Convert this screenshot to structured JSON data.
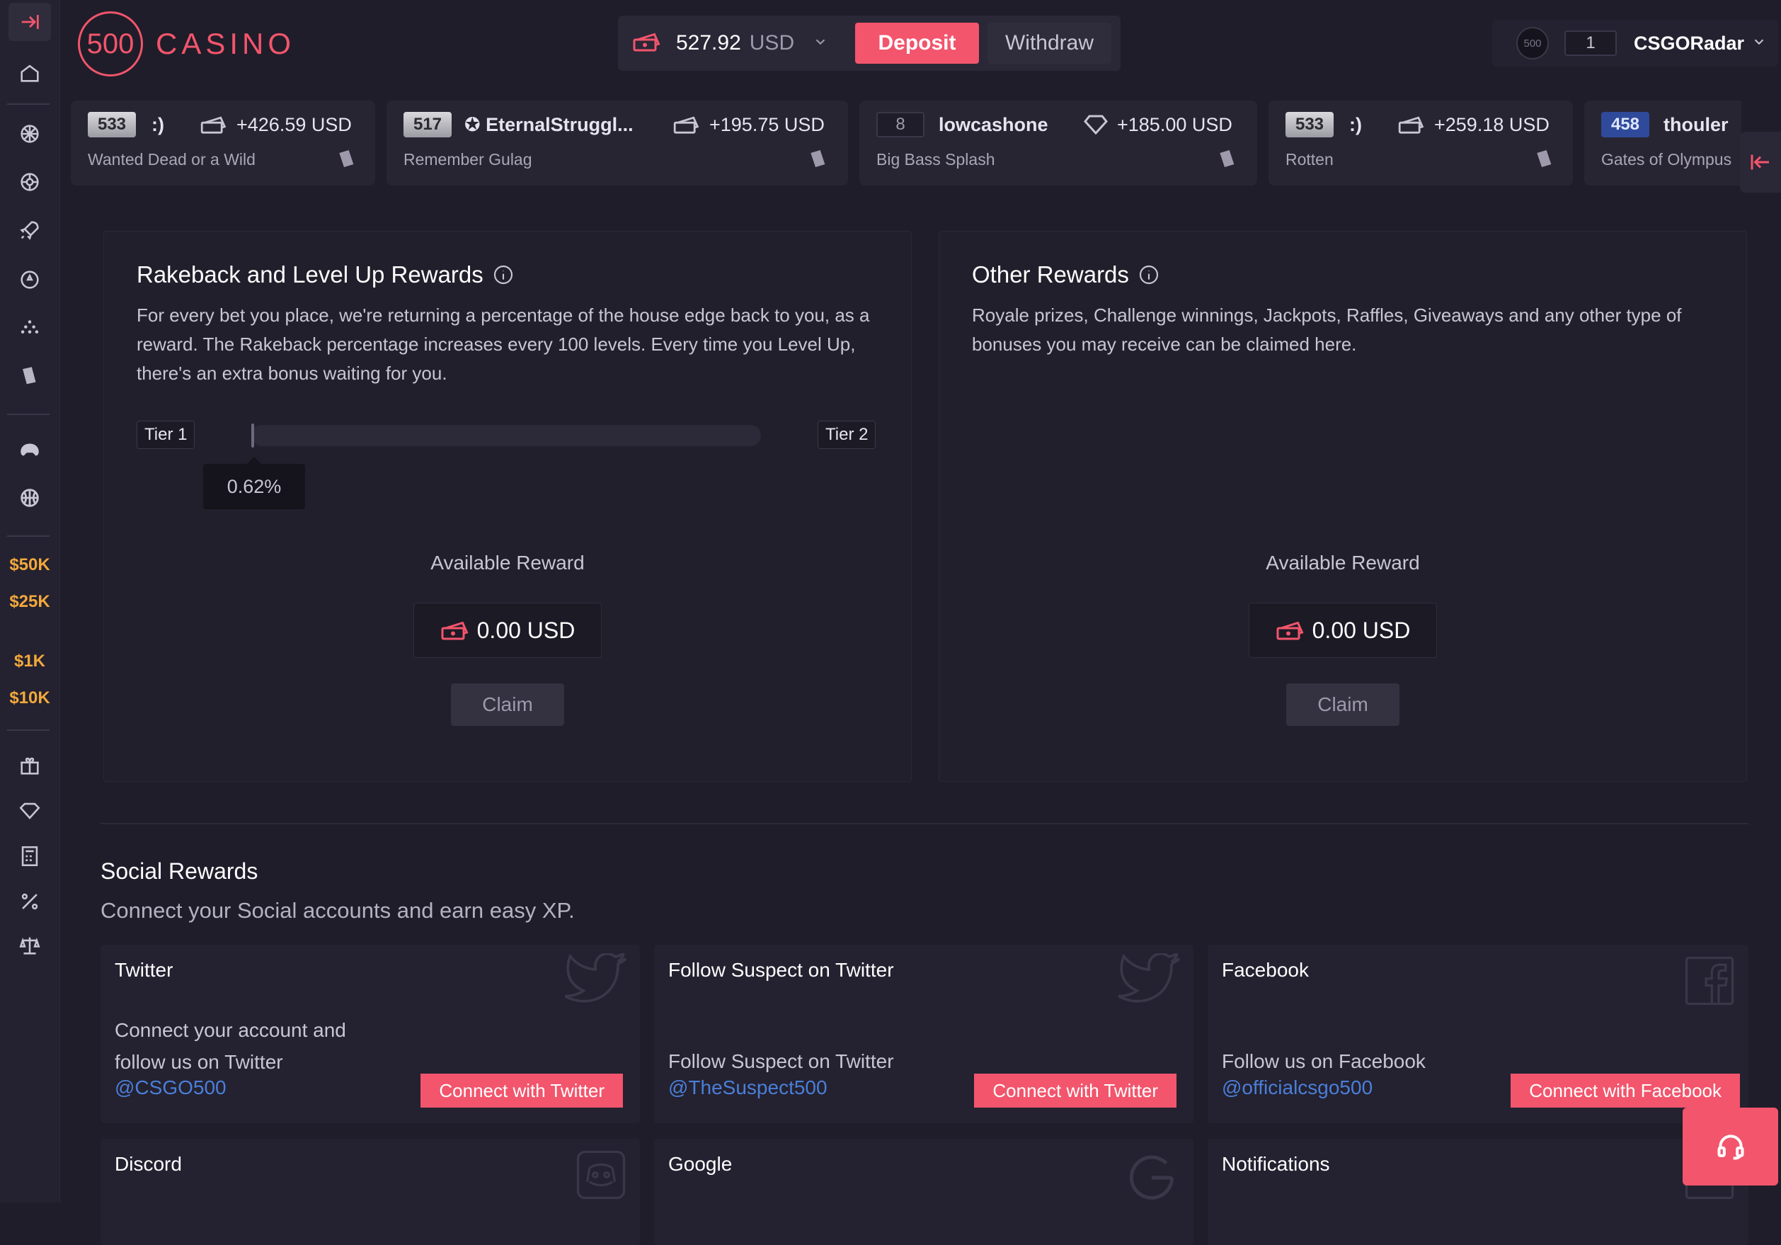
{
  "brand": {
    "logo_number": "500",
    "logo_text": "CASINO"
  },
  "colors": {
    "accent": "#f2556c",
    "jackpot": "#f2a93b",
    "link": "#4a7fd8",
    "background": "#1f1d29"
  },
  "sidebar": {
    "icons": [
      "collapse-icon",
      "home-icon",
      "roulette-icon",
      "wheel-icon",
      "rocket-icon",
      "dice-icon",
      "plinko-icon",
      "cards-icon",
      "esports-icon",
      "sports-icon",
      "gift-icon",
      "diamond-icon",
      "calculator-icon",
      "percent-icon",
      "scales-icon"
    ],
    "jackpots": [
      "$50K",
      "$25K",
      "$1K",
      "$10K"
    ]
  },
  "wallet": {
    "balance": "527.92",
    "currency": "USD",
    "deposit_label": "Deposit",
    "withdraw_label": "Withdraw"
  },
  "user": {
    "avatar_text": "500",
    "level": "1",
    "name": "CSGORadar"
  },
  "feed": [
    {
      "level": "533",
      "user": ":)",
      "amount": "+426.59 USD",
      "game": "Wanted Dead or a Wild",
      "icon": "cash-icon"
    },
    {
      "level": "517",
      "user": "✪ EternalStruggl...",
      "amount": "+195.75 USD",
      "game": "Remember Gulag",
      "icon": "cash-icon"
    },
    {
      "level": "8",
      "user": "lowcashone",
      "amount": "+185.00 USD",
      "game": "Big Bass Splash",
      "icon": "diamond-icon"
    },
    {
      "level": "533",
      "user": ":)",
      "amount": "+259.18 USD",
      "game": "Rotten",
      "icon": "cash-icon"
    },
    {
      "level": "458",
      "user": "thouler",
      "amount": "",
      "game": "Gates of Olympus",
      "icon": "cash-icon"
    }
  ],
  "rakeback": {
    "title": "Rakeback and Level Up Rewards",
    "description": "For every bet you place, we're returning a percentage of the house edge back to you, as a reward. The Rakeback percentage increases every 100 levels. Every time you Level Up, there's an extra bonus waiting for you.",
    "tier_from": "Tier 1",
    "tier_to": "Tier 2",
    "progress_label": "0.62%",
    "progress": 0.0062,
    "available_label": "Available Reward",
    "available_amount": "0.00 USD",
    "claim_label": "Claim"
  },
  "other": {
    "title": "Other Rewards",
    "description": "Royale prizes, Challenge winnings, Jackpots, Raffles, Giveaways and any other type of bonuses you may receive can be claimed here.",
    "available_label": "Available Reward",
    "available_amount": "0.00 USD",
    "claim_label": "Claim"
  },
  "social": {
    "title": "Social Rewards",
    "subtitle": "Connect your Social accounts and earn easy XP.",
    "cards": [
      {
        "title": "Twitter",
        "description": "Connect your account and follow us on Twitter",
        "handle": "@CSGO500",
        "button": "Connect with Twitter",
        "icon": "twitter-icon"
      },
      {
        "title": "Follow Suspect on Twitter",
        "description": "Follow Suspect on Twitter",
        "handle": "@TheSuspect500",
        "button": "Connect with Twitter",
        "icon": "twitter-icon"
      },
      {
        "title": "Facebook",
        "description": "Follow us on Facebook",
        "handle": "@officialcsgo500",
        "button": "Connect with Facebook",
        "icon": "facebook-icon"
      },
      {
        "title": "Discord",
        "icon": "discord-icon"
      },
      {
        "title": "Google",
        "icon": "google-icon"
      },
      {
        "title": "Notifications",
        "icon": "bell-icon"
      }
    ]
  }
}
